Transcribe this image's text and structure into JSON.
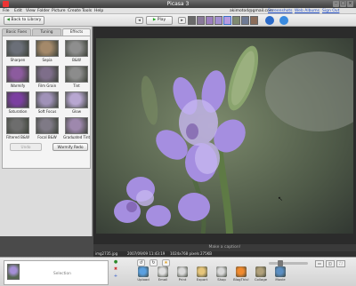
{
  "window": {
    "title": "Picasa 3"
  },
  "menu": {
    "items": [
      "File",
      "Edit",
      "View",
      "Folder",
      "Picture",
      "Create",
      "Tools",
      "Help"
    ],
    "account": {
      "email": "akimotod@gmail.com",
      "links": [
        "Screenshots",
        "Web Albums",
        "Sign Out"
      ]
    }
  },
  "toolbar": {
    "back_label": "Back to Library",
    "play_label": "Play"
  },
  "tabs": [
    "Basic Fixes",
    "Tuning",
    "Effects"
  ],
  "effects": [
    {
      "label": "Sharpen",
      "color": "#6b6f78"
    },
    {
      "label": "Sepia",
      "color": "#a4896a"
    },
    {
      "label": "B&W",
      "color": "#8e8e8e"
    },
    {
      "label": "Warmify",
      "color": "#8c5b9e"
    },
    {
      "label": "Film Grain",
      "color": "#7e6e8a"
    },
    {
      "label": "Tint",
      "color": "#8c8c8c"
    },
    {
      "label": "Saturation",
      "color": "#7b3fa0"
    },
    {
      "label": "Soft Focus",
      "color": "#a092b8"
    },
    {
      "label": "Glow",
      "color": "#b8a7d1"
    },
    {
      "label": "Filtered B&W",
      "color": "#6d6d6d"
    },
    {
      "label": "Focal B&W",
      "color": "#7f7a86"
    },
    {
      "label": "Graduated Tint",
      "color": "#9e88ad"
    }
  ],
  "buttons": {
    "undo": "Undo",
    "redo": "Warmify Redo"
  },
  "viewer": {
    "caption_placeholder": "Make a caption!"
  },
  "info": {
    "filename": "img2735.jpg",
    "date": "2007/09/09 11:43:19",
    "dimensions": "1024x768 pixels",
    "size": "275KB"
  },
  "tray": {
    "label": "Selection"
  },
  "actions": [
    {
      "label": "Upload",
      "color": "#5aa0e0"
    },
    {
      "label": "Email",
      "color": "#e0e0e0"
    },
    {
      "label": "Print",
      "color": "#d9d9d9"
    },
    {
      "label": "Export",
      "color": "#e6c57a"
    },
    {
      "label": "Shop",
      "color": "#d8d8d8"
    },
    {
      "label": "BlogThis!",
      "color": "#f08a2e"
    },
    {
      "label": "Collage",
      "color": "#b0a07a"
    },
    {
      "label": "Movie",
      "color": "#5b8ec2"
    }
  ],
  "zoom": {
    "level": 0.25
  },
  "colors": {
    "accent": "#3a6fc4",
    "panel": "#dcdcdc",
    "viewer": "#2b2b2b"
  }
}
